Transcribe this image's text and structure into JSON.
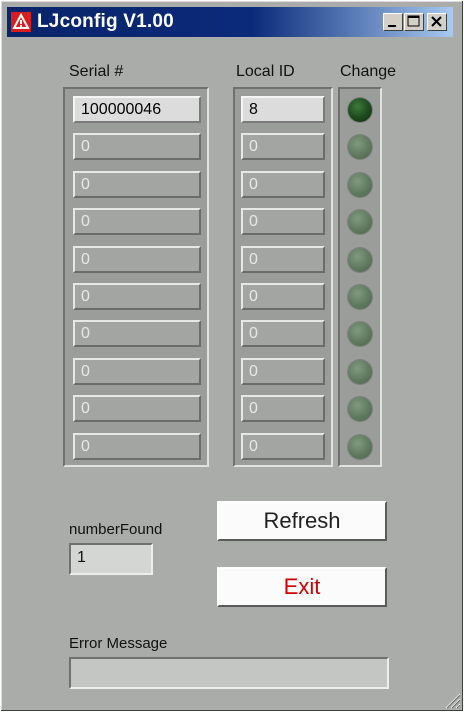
{
  "window": {
    "title": "LJconfig V1.00",
    "icon": "labjack-warning-icon"
  },
  "columns": {
    "serial_header": "Serial #",
    "local_id_header": "Local ID",
    "change_header": "Change"
  },
  "rows": [
    {
      "serial": "100000046",
      "local_id": "8",
      "change_led": "on"
    },
    {
      "serial": "0",
      "local_id": "0",
      "change_led": "off"
    },
    {
      "serial": "0",
      "local_id": "0",
      "change_led": "off"
    },
    {
      "serial": "0",
      "local_id": "0",
      "change_led": "off"
    },
    {
      "serial": "0",
      "local_id": "0",
      "change_led": "off"
    },
    {
      "serial": "0",
      "local_id": "0",
      "change_led": "off"
    },
    {
      "serial": "0",
      "local_id": "0",
      "change_led": "off"
    },
    {
      "serial": "0",
      "local_id": "0",
      "change_led": "off"
    },
    {
      "serial": "0",
      "local_id": "0",
      "change_led": "off"
    },
    {
      "serial": "0",
      "local_id": "0",
      "change_led": "off"
    }
  ],
  "number_found": {
    "label": "numberFound",
    "value": "1"
  },
  "buttons": {
    "refresh": "Refresh",
    "exit": "Exit"
  },
  "error": {
    "label": "Error Message",
    "value": ""
  },
  "colors": {
    "title_bar_start": "#0a246a",
    "title_bar_end": "#a6caf0",
    "panel_background": "#a9aca9",
    "exit_text": "#cc0000",
    "led_on": "#1f4d1f",
    "led_off": "#5f7a5f"
  }
}
